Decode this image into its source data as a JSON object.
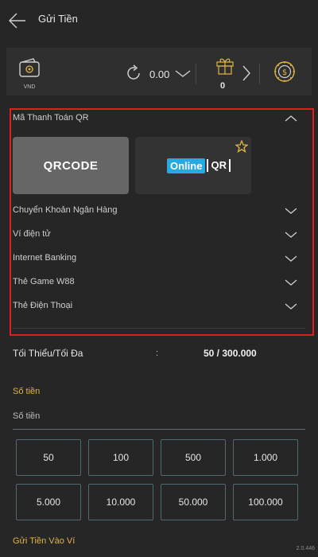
{
  "header": {
    "back_icon": "arrow-left-icon",
    "title": "Gửi Tiền"
  },
  "topbar": {
    "wallet_icon": "wallet-icon",
    "currency": "VND",
    "refresh_icon": "refresh-icon",
    "balance": "0.00",
    "gift_icon": "gift-icon",
    "gift_count": "0",
    "wheel_icon": "lucky-wheel-icon"
  },
  "payment": {
    "qr_section": {
      "label": "Mã Thanh Toán QR",
      "expanded": true,
      "methods": [
        {
          "label": "QRCODE",
          "selected": true
        },
        {
          "label_online": "Online",
          "label_qr": "QR",
          "favorite": true
        }
      ]
    },
    "sections": [
      {
        "label": "Chuyển Khoản Ngân Hàng"
      },
      {
        "label": "Ví điện tử"
      },
      {
        "label": "Internet Banking"
      },
      {
        "label": "Thẻ Game W88"
      },
      {
        "label": "Thẻ Điện Thoại"
      }
    ]
  },
  "limits": {
    "label": "Tối Thiểu/Tối Đa",
    "colon": ":",
    "value": "50 / 300.000"
  },
  "amount": {
    "title": "Số tiền",
    "placeholder": "Số tiền",
    "presets": [
      "50",
      "100",
      "500",
      "1.000",
      "5.000",
      "10.000",
      "50.000",
      "100.000"
    ]
  },
  "footer": {
    "label": "Gửi Tiền Vào Ví",
    "version": "2.0.446"
  },
  "colors": {
    "background": "#262626",
    "accent_gold": "#e0b545",
    "highlight_red": "#e01f1f",
    "online_blue": "#27a9e1"
  }
}
